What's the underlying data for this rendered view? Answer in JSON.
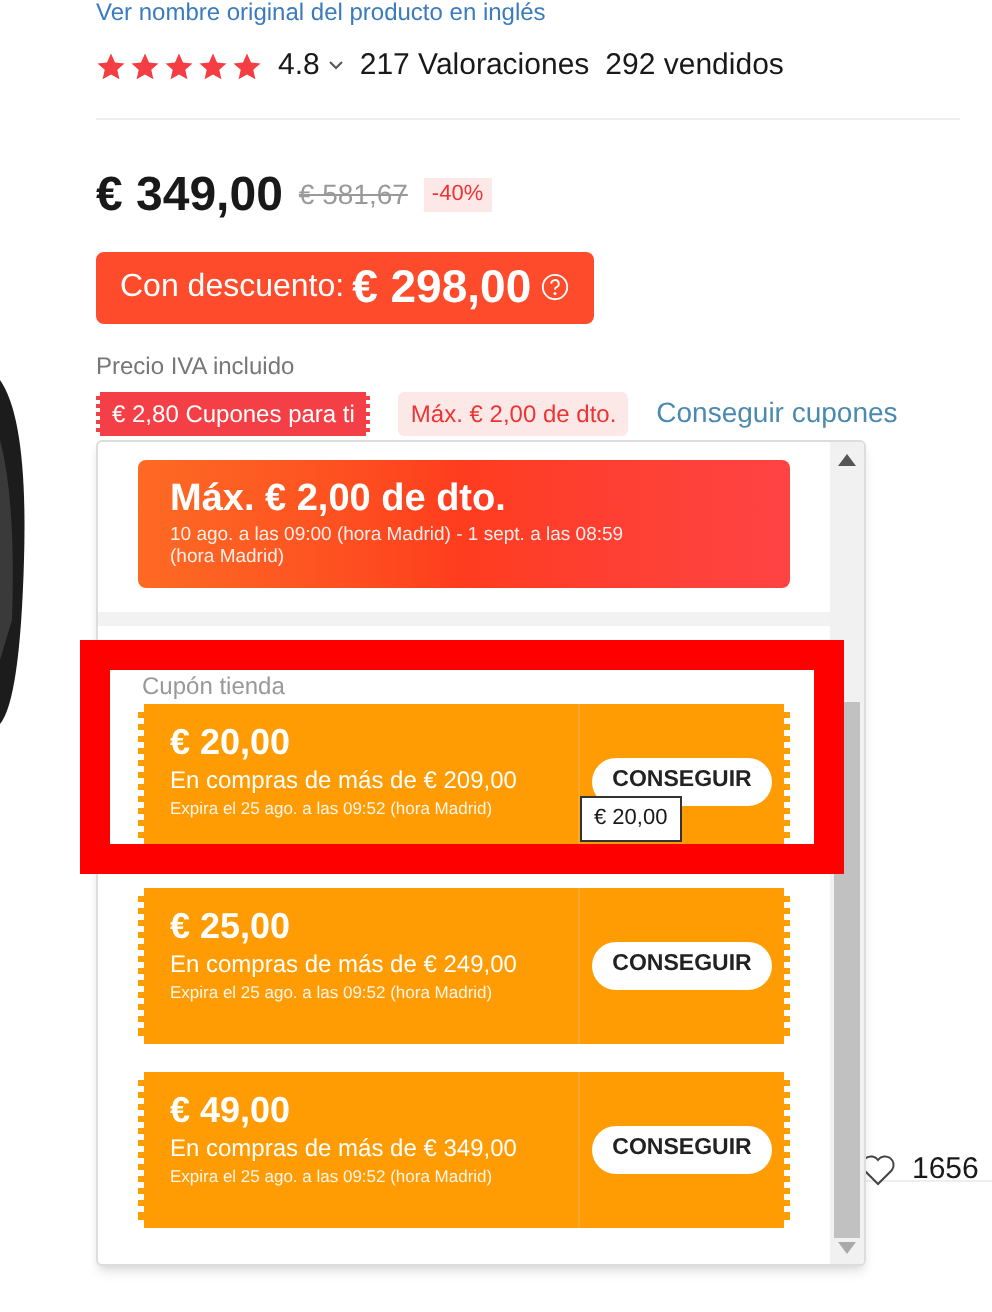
{
  "translate_link": "Ver nombre original del producto en inglés",
  "rating": {
    "stars": 5,
    "value": "4.8",
    "reviews": "217 Valoraciones",
    "sold": "292 vendidos"
  },
  "price": {
    "current": "€ 349,00",
    "original": "€ 581,67",
    "discount": "-40%"
  },
  "discounted": {
    "label": "Con descuento:",
    "amount": "€ 298,00"
  },
  "tax_note": "Precio IVA incluido",
  "coupon_tag": "€ 2,80 Cupones para ti",
  "max_tag": "Máx. € 2,00 de dto.",
  "get_coupons_link": "Conseguir cupones",
  "popup": {
    "promo": {
      "title": "Máx. € 2,00 de dto.",
      "period": "10 ago. a las 09:00 (hora Madrid) - 1 sept. a las 08:59 (hora Madrid)"
    },
    "section_title": "Cupón tienda",
    "coupons": [
      {
        "amount": "€ 20,00",
        "condition": "En compras de más de € 209,00",
        "expiry": "Expira el 25 ago. a las 09:52 (hora Madrid)",
        "button": "CONSEGUIR"
      },
      {
        "amount": "€ 25,00",
        "condition": "En compras de más de € 249,00",
        "expiry": "Expira el 25 ago. a las 09:52 (hora Madrid)",
        "button": "CONSEGUIR"
      },
      {
        "amount": "€ 49,00",
        "condition": "En compras de más de € 349,00",
        "expiry": "Expira el 25 ago. a las 09:52 (hora Madrid)",
        "button": "CONSEGUIR"
      }
    ],
    "tooltip": "€ 20,00"
  },
  "likes": "1656"
}
